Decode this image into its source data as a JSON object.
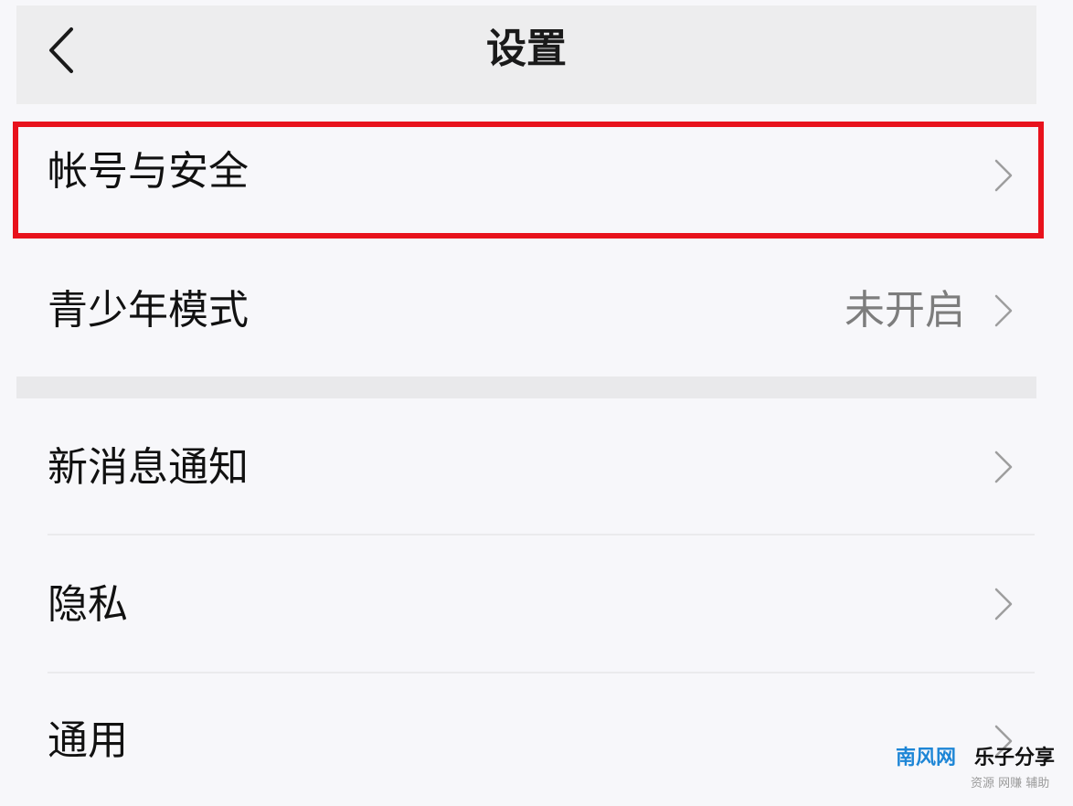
{
  "header": {
    "title": "设置",
    "back_icon": "chevron-left-icon"
  },
  "settings": {
    "account_security": {
      "label": "帐号与安全",
      "highlighted": true,
      "highlight_color": "#e8121c"
    },
    "youth_mode": {
      "label": "青少年模式",
      "value": "未开启"
    },
    "notifications": {
      "label": "新消息通知"
    },
    "privacy": {
      "label": "隐私"
    },
    "general": {
      "label": "通用"
    }
  },
  "watermark": {
    "brand": "南风网",
    "name": "乐子分享",
    "subtitle": "资源 网赚 辅助"
  },
  "colors": {
    "background": "#f7f7fa",
    "header_background": "#ededee",
    "highlight_border": "#e8121c",
    "secondary_text": "#7d7d7d",
    "watermark_brand": "#1e86d6"
  }
}
